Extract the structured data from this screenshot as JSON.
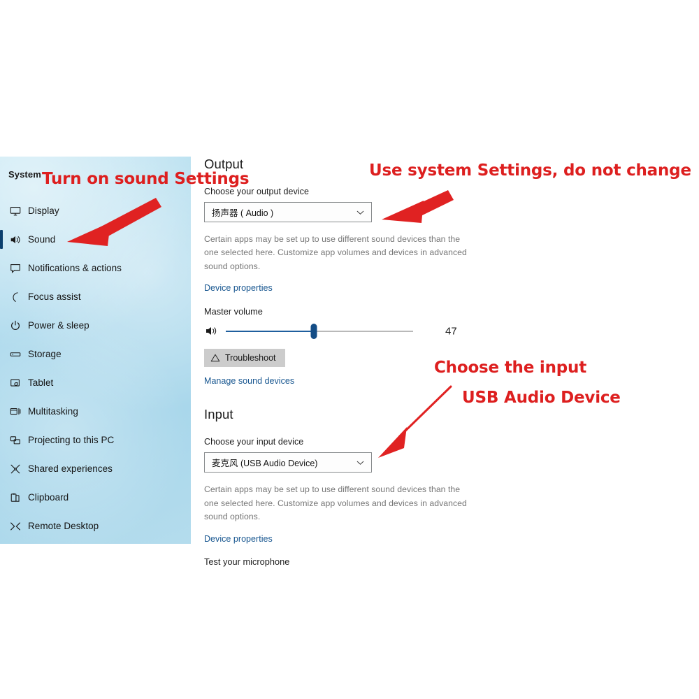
{
  "sidebar": {
    "title": "System",
    "items": [
      {
        "label": "Display",
        "icon": "monitor-icon",
        "selected": false
      },
      {
        "label": "Sound",
        "icon": "speaker-icon",
        "selected": true
      },
      {
        "label": "Notifications & actions",
        "icon": "chat-icon",
        "selected": false
      },
      {
        "label": "Focus assist",
        "icon": "moon-icon",
        "selected": false
      },
      {
        "label": "Power & sleep",
        "icon": "power-icon",
        "selected": false
      },
      {
        "label": "Storage",
        "icon": "drive-icon",
        "selected": false
      },
      {
        "label": "Tablet",
        "icon": "tablet-icon",
        "selected": false
      },
      {
        "label": "Multitasking",
        "icon": "multitask-icon",
        "selected": false
      },
      {
        "label": "Projecting to this PC",
        "icon": "project-icon",
        "selected": false
      },
      {
        "label": "Shared experiences",
        "icon": "share-icon",
        "selected": false
      },
      {
        "label": "Clipboard",
        "icon": "clipboard-icon",
        "selected": false
      },
      {
        "label": "Remote Desktop",
        "icon": "remote-icon",
        "selected": false
      }
    ]
  },
  "output": {
    "heading": "Output",
    "choose_label": "Choose your output device",
    "device_value": "扬声器 ( Audio )",
    "note": "Certain apps may be set up to use different sound devices than the one selected here. Customize app volumes and devices in advanced sound options.",
    "device_properties_link": "Device properties",
    "master_volume_label": "Master volume",
    "volume_value": "47",
    "volume_percent": 47,
    "troubleshoot_label": "Troubleshoot",
    "manage_link": "Manage sound devices"
  },
  "input": {
    "heading": "Input",
    "choose_label": "Choose your input device",
    "device_value": "麦克风 (USB Audio Device)",
    "note": "Certain apps may be set up to use different sound devices than the one selected here. Customize app volumes and devices in advanced sound options.",
    "device_properties_link": "Device properties",
    "test_mic_label": "Test your microphone"
  },
  "annotations": {
    "color": "#dd1f1f",
    "turn_on": "Turn on sound Settings",
    "use_system": "Use system Settings, do not change",
    "choose_input_line1": "Choose the input",
    "choose_input_line2": "USB Audio Device"
  }
}
